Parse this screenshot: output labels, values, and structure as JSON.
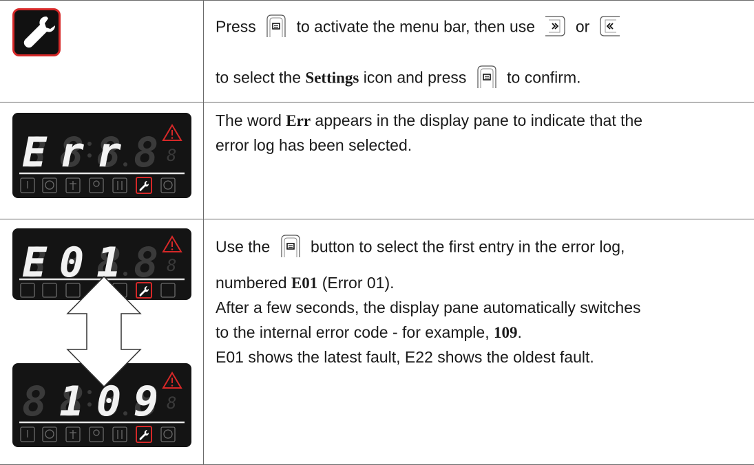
{
  "rows": [
    {
      "line1": {
        "press": "Press",
        "activate": "to activate the menu bar, then use",
        "or": "or"
      },
      "line2": {
        "select": "to select the",
        "settings": "Settings",
        "icon_press": "icon and press",
        "confirm": "to confirm."
      }
    },
    {
      "line1": {
        "the_word": "The word",
        "err": "Err",
        "rest": "appears in the display pane to indicate that the"
      },
      "line2": "error log has been selected.",
      "display_chars": [
        "E",
        "r",
        "r",
        "8"
      ]
    },
    {
      "line1": {
        "use_the": "Use the",
        "rest": "button to select the first entry in the error log,"
      },
      "line2": {
        "numbered": "numbered",
        "e01": "E01",
        "paren": "(Error 01)."
      },
      "line3": "After a few seconds, the display pane automatically switches",
      "line4": {
        "prefix": "to the internal error code - for example,",
        "code": "109",
        "suffix": "."
      },
      "line5": "E01 shows the latest fault, E22 shows the oldest fault.",
      "display_top_chars": [
        "E",
        "0",
        "1",
        "8"
      ],
      "display_bottom_chars": [
        "8",
        "1",
        "0",
        "9"
      ]
    }
  ],
  "icons": [
    "settings-wrench-icon",
    "menu-key-icon",
    "arrow-right-key-icon",
    "arrow-left-key-icon",
    "warning-triangle-icon",
    "thermometer-icon",
    "fan-icon",
    "plug-icon",
    "bulb-icon",
    "temp-arrows-icon",
    "wrench-icon",
    "power-icon",
    "double-arrow-icon"
  ],
  "colors": {
    "accent_red": "#d62828",
    "display_bg": "#141414",
    "segment_on": "#f2f2f2",
    "segment_off": "#3a3a3a",
    "grid_line": "#6b6b6b"
  }
}
